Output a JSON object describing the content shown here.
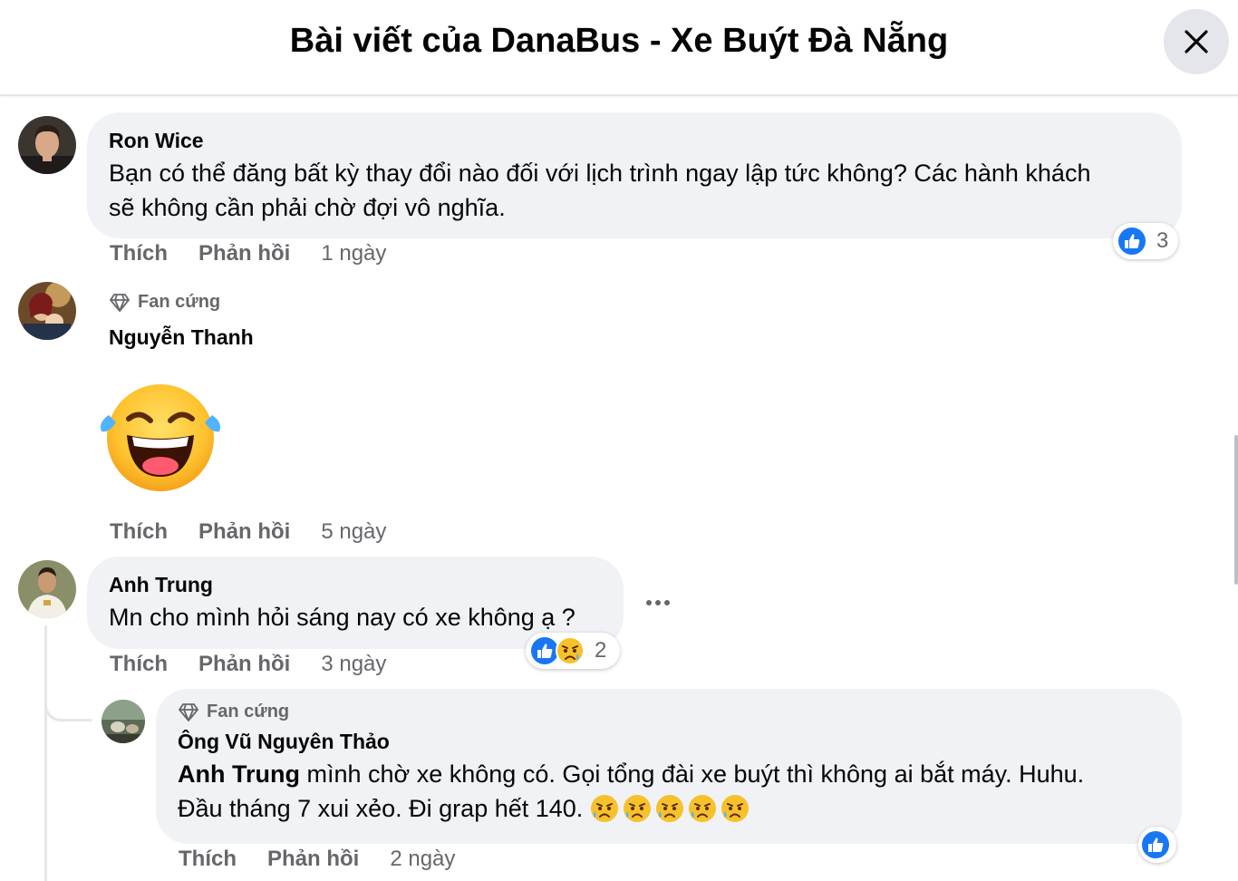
{
  "header": {
    "title": "Bài viết của DanaBus - Xe Buýt Đà Nẵng"
  },
  "labels": {
    "like": "Thích",
    "reply": "Phản hồi",
    "fan_badge": "Fan cứng"
  },
  "comments": [
    {
      "author": "Ron Wice",
      "text_line1": "Bạn có thể đăng bất kỳ thay đổi nào đối với lịch trình ngay lập tức không? Các hành khách",
      "text_line2": "sẽ không cần phải chờ đợi vô nghĩa.",
      "time": "1 ngày",
      "reaction_count": "3"
    },
    {
      "author": "Nguyễn Thanh",
      "sticker": "laughing-tears-emoji",
      "time": "5 ngày"
    },
    {
      "author": "Anh Trung",
      "text": "Mn cho mình hỏi sáng nay có xe không ạ ?",
      "time": "3 ngày",
      "reaction_count": "2"
    }
  ],
  "reply": {
    "author": "Ông Vũ Nguyên Thảo",
    "mention": "Anh Trung",
    "text_line1": " mình chờ xe không có. Gọi tổng đài xe buýt thì không ai bắt máy. Huhu.",
    "text_line2": "Đầu tháng 7 xui xẻo. Đi grap hết 140.",
    "emoji_count": 5,
    "time": "2 ngày"
  },
  "colors": {
    "accent": "#1877f2",
    "bubble": "#f0f2f5",
    "muted": "#65676b"
  }
}
